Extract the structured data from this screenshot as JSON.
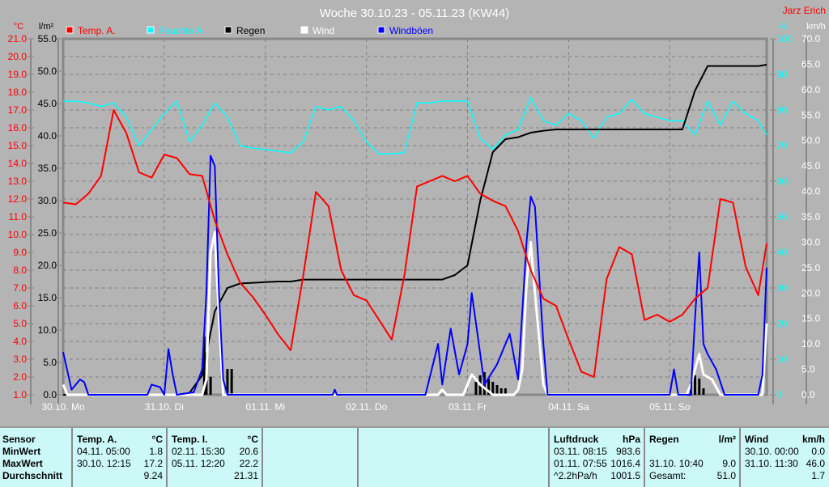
{
  "title": "Woche 30.10.23 - 05.11.23 (KW44)",
  "author": "Jarz Erich",
  "colors": {
    "temp": "#ff0000",
    "hum": "#00ffff",
    "rain": "#000000",
    "wind": "#ffffff",
    "gust": "#0000ff",
    "bg": "#b4b4b4",
    "grid": "#808080"
  },
  "chart_data": {
    "type": "line",
    "title": "Woche 30.10.23 - 05.11.23 (KW44)",
    "x_unit": "hours since 30.10. 00:00",
    "xlim": [
      0,
      167
    ],
    "day_labels": [
      "30.10. Mo",
      "31.10. Di",
      "01.11. Mi",
      "02.11. Do",
      "03.11. Fr",
      "04.11. Sa",
      "05.11. So"
    ],
    "axes": {
      "temp": {
        "label": "°C",
        "ylim": [
          1,
          21
        ],
        "ticks": [
          "1.0",
          "2.0",
          "3.0",
          "4.0",
          "5.0",
          "6.0",
          "7.0",
          "8.0",
          "9.0",
          "10.0",
          "11.0",
          "12.0",
          "13.0",
          "14.0",
          "15.0",
          "16.0",
          "17.0",
          "18.0",
          "19.0",
          "20.0",
          "21.0"
        ]
      },
      "rain": {
        "label": "l/m²",
        "ylim": [
          0,
          55
        ],
        "ticks": [
          "0.0",
          "5.0",
          "10.0",
          "15.0",
          "20.0",
          "25.0",
          "30.0",
          "35.0",
          "40.0",
          "45.0",
          "50.0",
          "55.0"
        ]
      },
      "hum": {
        "label": "%",
        "ylim": [
          0,
          100
        ],
        "ticks": [
          "0",
          "10",
          "20",
          "30",
          "40",
          "50",
          "60",
          "70",
          "80",
          "90",
          "100"
        ]
      },
      "wind": {
        "label": "km/h",
        "ylim": [
          0,
          70
        ],
        "ticks": [
          "0.0",
          "5.0",
          "10.0",
          "15.0",
          "20.0",
          "25.0",
          "30.0",
          "35.0",
          "40.0",
          "45.0",
          "50.0",
          "55.0",
          "60.0",
          "65.0",
          "70.0"
        ]
      }
    },
    "legend": [
      {
        "key": "temp",
        "label": "Temp. A."
      },
      {
        "key": "hum",
        "label": "Feuchte A."
      },
      {
        "key": "rain",
        "label": "Regen"
      },
      {
        "key": "wind",
        "label": "Wind"
      },
      {
        "key": "gust",
        "label": "Windböen"
      }
    ],
    "series": {
      "temp": {
        "axis": "temp",
        "step_hours": 3,
        "values": [
          11.8,
          11.7,
          12.3,
          13.3,
          17.0,
          15.7,
          13.5,
          13.2,
          14.5,
          14.3,
          13.4,
          13.3,
          10.8,
          8.9,
          7.3,
          6.5,
          5.5,
          4.4,
          3.5,
          7.7,
          12.4,
          11.6,
          8.0,
          6.6,
          6.3,
          5.2,
          4.1,
          7.7,
          12.7,
          13.0,
          13.3,
          13.0,
          13.3,
          12.3,
          11.9,
          11.6,
          10.2,
          8.0,
          6.4,
          6.0,
          4.1,
          2.3,
          2.0,
          7.5,
          9.3,
          8.9,
          5.2,
          5.5,
          5.1,
          5.5,
          6.4,
          7.0,
          12.0,
          11.8,
          8.2,
          6.6,
          9.5
        ]
      },
      "hum": {
        "axis": "hum",
        "step_hours": 3,
        "values": [
          82.5,
          82.5,
          82,
          81,
          82,
          78,
          70,
          74.5,
          79,
          82.5,
          71,
          75.7,
          82,
          78,
          70,
          69.3,
          68.9,
          68.4,
          68,
          71,
          81,
          80,
          81,
          77,
          71,
          67.7,
          67.7,
          68,
          82,
          82,
          82.5,
          82.5,
          82.5,
          72,
          69,
          73,
          74.5,
          83.6,
          77,
          75.7,
          79,
          77,
          72,
          78,
          79,
          83,
          79,
          78,
          77,
          77,
          73,
          82.5,
          75.7,
          82.5,
          79,
          77,
          73
        ]
      },
      "rain": {
        "axis": "rain",
        "step_hours": 3,
        "values": [
          0,
          0,
          0,
          0,
          0,
          0,
          0,
          0,
          0,
          0,
          0.3,
          3,
          12.9,
          16.5,
          17.2,
          17.3,
          17.4,
          17.5,
          17.5,
          17.8,
          17.8,
          17.8,
          17.8,
          17.8,
          17.8,
          17.8,
          17.8,
          17.8,
          17.8,
          17.8,
          17.8,
          18.5,
          20,
          30,
          37.5,
          39.5,
          39.8,
          40.5,
          40.8,
          41,
          41,
          41,
          41,
          41,
          41,
          41,
          41,
          41,
          41,
          41,
          47,
          50.8,
          50.8,
          50.8,
          50.8,
          50.8,
          51
        ]
      },
      "rain_bars": {
        "axis": "rain",
        "points": [
          [
            33.5,
            9
          ],
          [
            34,
            3
          ],
          [
            35,
            2.8
          ],
          [
            39,
            4
          ],
          [
            40,
            4
          ],
          [
            98,
            2
          ],
          [
            99,
            3
          ],
          [
            100,
            3.5
          ],
          [
            101,
            2.5
          ],
          [
            102,
            2
          ],
          [
            103,
            1.5
          ],
          [
            104,
            1
          ],
          [
            105,
            1
          ],
          [
            149,
            2
          ],
          [
            150,
            3
          ],
          [
            151,
            2.5
          ],
          [
            152,
            1
          ]
        ]
      },
      "wind": {
        "axis": "wind",
        "points": [
          [
            0,
            2
          ],
          [
            1,
            0
          ],
          [
            33,
            0
          ],
          [
            34,
            3
          ],
          [
            35,
            28
          ],
          [
            36,
            32
          ],
          [
            37,
            15
          ],
          [
            38,
            0
          ],
          [
            89,
            0
          ],
          [
            90,
            1
          ],
          [
            91,
            0
          ],
          [
            95,
            0
          ],
          [
            96,
            2
          ],
          [
            97,
            4
          ],
          [
            99,
            2
          ],
          [
            102,
            0
          ],
          [
            107,
            0
          ],
          [
            108,
            1
          ],
          [
            109,
            5
          ],
          [
            110,
            22
          ],
          [
            111,
            30
          ],
          [
            112,
            20
          ],
          [
            114,
            2
          ],
          [
            115,
            0
          ],
          [
            148,
            0
          ],
          [
            149,
            2
          ],
          [
            150,
            5
          ],
          [
            151,
            8
          ],
          [
            152,
            4
          ],
          [
            154,
            3
          ],
          [
            156,
            0
          ],
          [
            166,
            0
          ],
          [
            167,
            14
          ]
        ]
      },
      "gust": {
        "axis": "wind",
        "points": [
          [
            0,
            8.4
          ],
          [
            2,
            1
          ],
          [
            4,
            3
          ],
          [
            5,
            2.5
          ],
          [
            6,
            0
          ],
          [
            20,
            0
          ],
          [
            21,
            2
          ],
          [
            23,
            1.5
          ],
          [
            24,
            0
          ],
          [
            25,
            9
          ],
          [
            26,
            4
          ],
          [
            27,
            0
          ],
          [
            31,
            0.5
          ],
          [
            33,
            5
          ],
          [
            34,
            20
          ],
          [
            35,
            47
          ],
          [
            36,
            45
          ],
          [
            37,
            20
          ],
          [
            38,
            3
          ],
          [
            39,
            0
          ],
          [
            64,
            0
          ],
          [
            64.5,
            1
          ],
          [
            65,
            0
          ],
          [
            86,
            0
          ],
          [
            89,
            10
          ],
          [
            90,
            2
          ],
          [
            92,
            13
          ],
          [
            94,
            4
          ],
          [
            96,
            10
          ],
          [
            97,
            20
          ],
          [
            98,
            14
          ],
          [
            100,
            2
          ],
          [
            103,
            6
          ],
          [
            106,
            12
          ],
          [
            108,
            3
          ],
          [
            110,
            30
          ],
          [
            111,
            39
          ],
          [
            112,
            37
          ],
          [
            114,
            10
          ],
          [
            115,
            0
          ],
          [
            144,
            0
          ],
          [
            145,
            5
          ],
          [
            146,
            0
          ],
          [
            149,
            0
          ],
          [
            150,
            15
          ],
          [
            151,
            28
          ],
          [
            152,
            10
          ],
          [
            153,
            8
          ],
          [
            155,
            5
          ],
          [
            157,
            0
          ],
          [
            165,
            0
          ],
          [
            166,
            4
          ],
          [
            167,
            25
          ]
        ]
      }
    }
  },
  "table": {
    "columns": [
      {
        "head": "Sensor",
        "rows": [
          "MinWert",
          "MaxWert",
          "Durchschnitt"
        ]
      },
      {
        "head": "Temp. A.",
        "unit": "°C",
        "rows": [
          [
            "04.11.  05:00",
            "1.8"
          ],
          [
            "30.10.  12:15",
            "17.2"
          ],
          [
            "",
            "9.24"
          ]
        ]
      },
      {
        "head": "Temp. I.",
        "unit": "°C",
        "rows": [
          [
            "02.11.  15:30",
            "20.6"
          ],
          [
            "05.11.  12:20",
            "22.2"
          ],
          [
            "",
            "21.31"
          ]
        ]
      },
      {
        "head": "Luftdruck",
        "unit": "hPa",
        "rows": [
          [
            "03.11.  08:15",
            "983.6"
          ],
          [
            "01.11.  07:55",
            "1016.4"
          ],
          [
            "^2.2hPa/h",
            "1001.5"
          ]
        ]
      },
      {
        "head": "Regen",
        "unit": "l/m²",
        "rows": [
          [
            "",
            ""
          ],
          [
            "31.10.  10:40",
            "9.0"
          ],
          [
            "Gesamt:",
            "51.0"
          ]
        ]
      },
      {
        "head": "Wind",
        "unit": "km/h",
        "rows": [
          [
            "30.10.  00:00",
            "0.0"
          ],
          [
            "31.10.  11:30",
            "46.0"
          ],
          [
            "",
            "1.7"
          ]
        ]
      }
    ]
  }
}
